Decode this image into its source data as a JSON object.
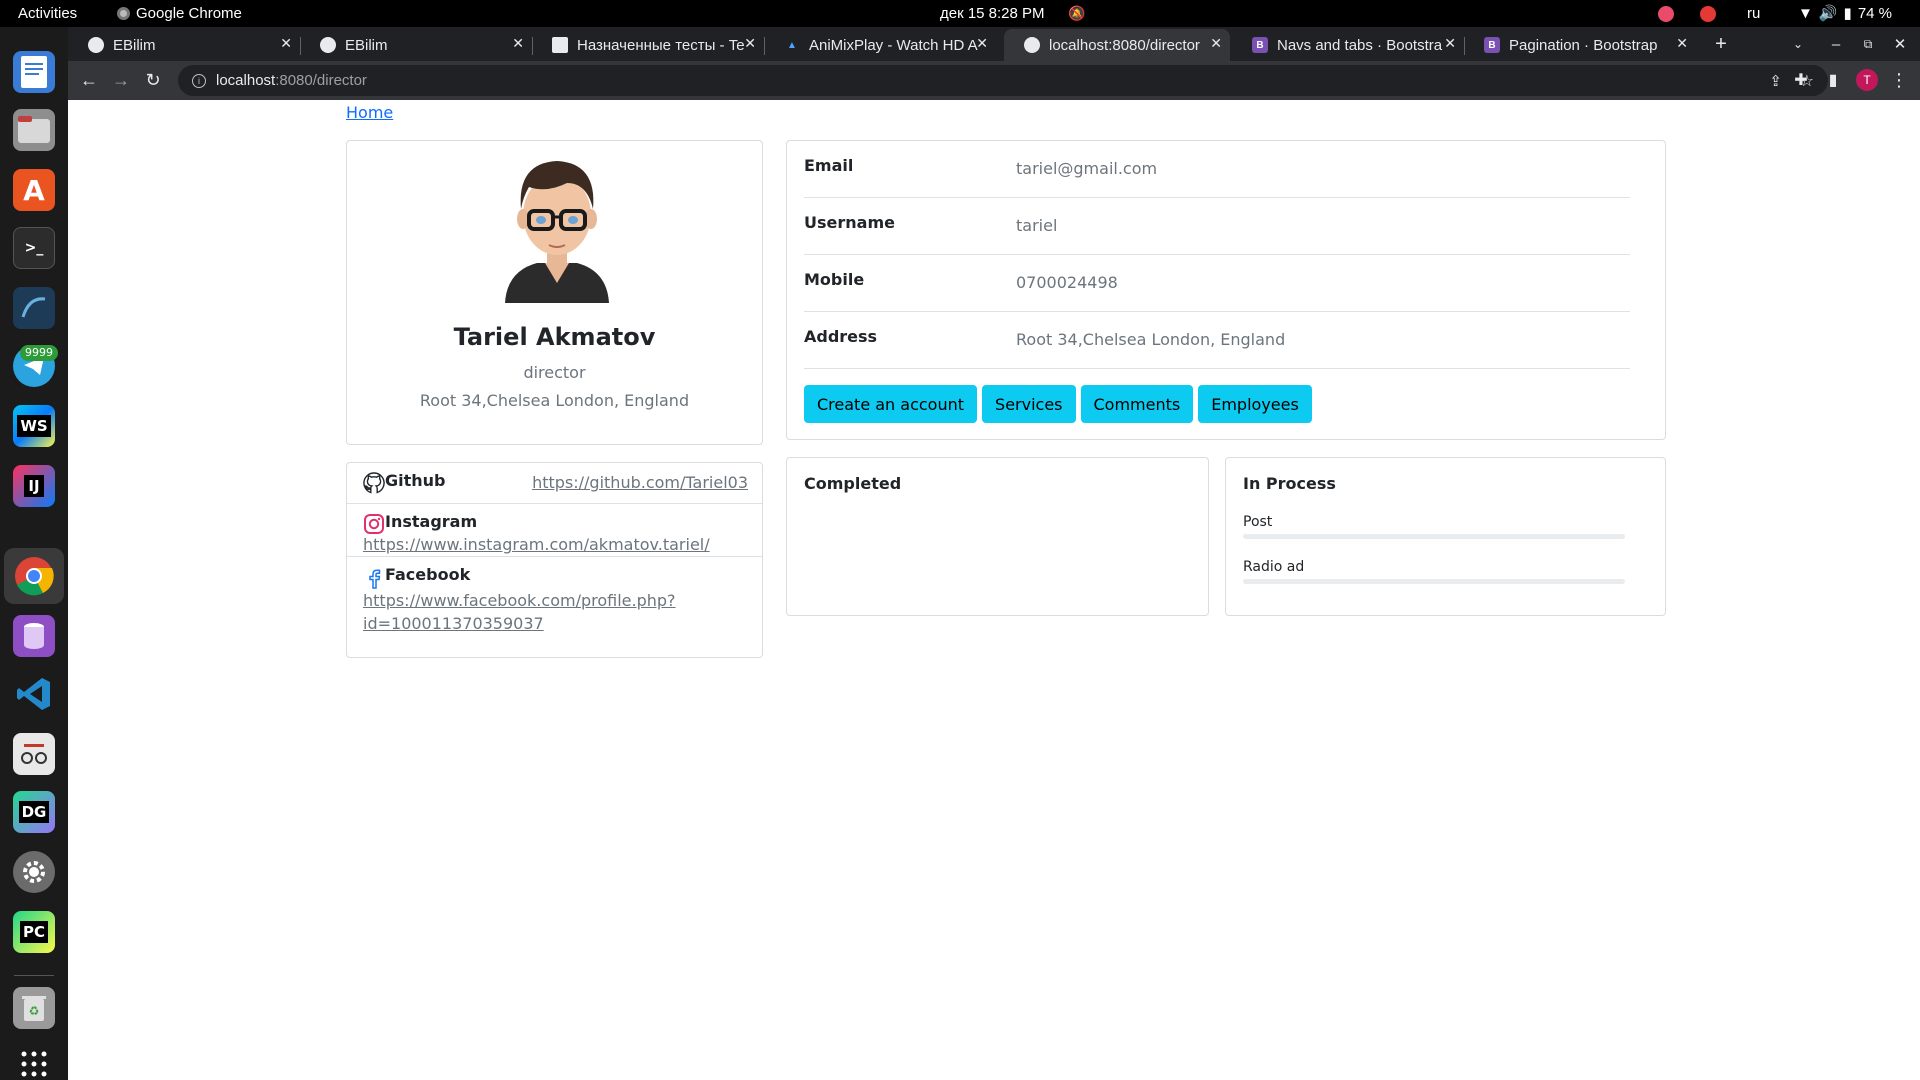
{
  "topbar": {
    "activities": "Activities",
    "app_name": "Google Chrome",
    "datetime": "дек 15  8:28 PM",
    "lang": "ru",
    "battery": "74 %"
  },
  "dock": {
    "telegram_badge": "9999",
    "webstorm_label": "WS",
    "intellij_label": "IJ",
    "datagrip_label": "DG",
    "pycharm_label": "PC"
  },
  "tabs": [
    {
      "title": "EBilim",
      "active": false
    },
    {
      "title": "EBilim",
      "active": false
    },
    {
      "title": "Назначенные тесты - Te",
      "active": false
    },
    {
      "title": "AniMixPlay - Watch HD A",
      "active": false
    },
    {
      "title": "localhost:8080/director",
      "active": true
    },
    {
      "title": "Navs and tabs · Bootstra",
      "active": false
    },
    {
      "title": "Pagination · Bootstrap",
      "active": false
    }
  ],
  "address": {
    "host": "localhost",
    "path": ":8080/director"
  },
  "profile_avatar_letter": "T",
  "page": {
    "breadcrumb": "Home",
    "profile": {
      "name": "Tariel Akmatov",
      "role": "director",
      "address": "Root 34,Chelsea London, England"
    },
    "details": [
      {
        "label": "Email",
        "value": "tariel@gmail.com"
      },
      {
        "label": "Username",
        "value": "tariel"
      },
      {
        "label": "Mobile",
        "value": "0700024498"
      },
      {
        "label": "Address",
        "value": "Root 34,Chelsea London, England"
      }
    ],
    "buttons": [
      "Create an account",
      "Services",
      "Comments",
      "Employees"
    ],
    "social": {
      "github": {
        "label": "Github",
        "url": "https://github.com/Tariel03"
      },
      "instagram": {
        "label": "Instagram",
        "url": "https://www.instagram.com/akmatov.tariel/"
      },
      "facebook": {
        "label": "Facebook",
        "url_line1": "https://www.facebook.com/profile.php?",
        "url_line2": "id=100011370359037"
      }
    },
    "completed": {
      "title": "Completed"
    },
    "in_process": {
      "title": "In Process",
      "items": [
        {
          "label": "Post",
          "progress": 0
        },
        {
          "label": "Radio ad",
          "progress": 0
        }
      ]
    }
  },
  "colors": {
    "accent_button": "#0dcaf0",
    "link": "#0d6efd"
  }
}
